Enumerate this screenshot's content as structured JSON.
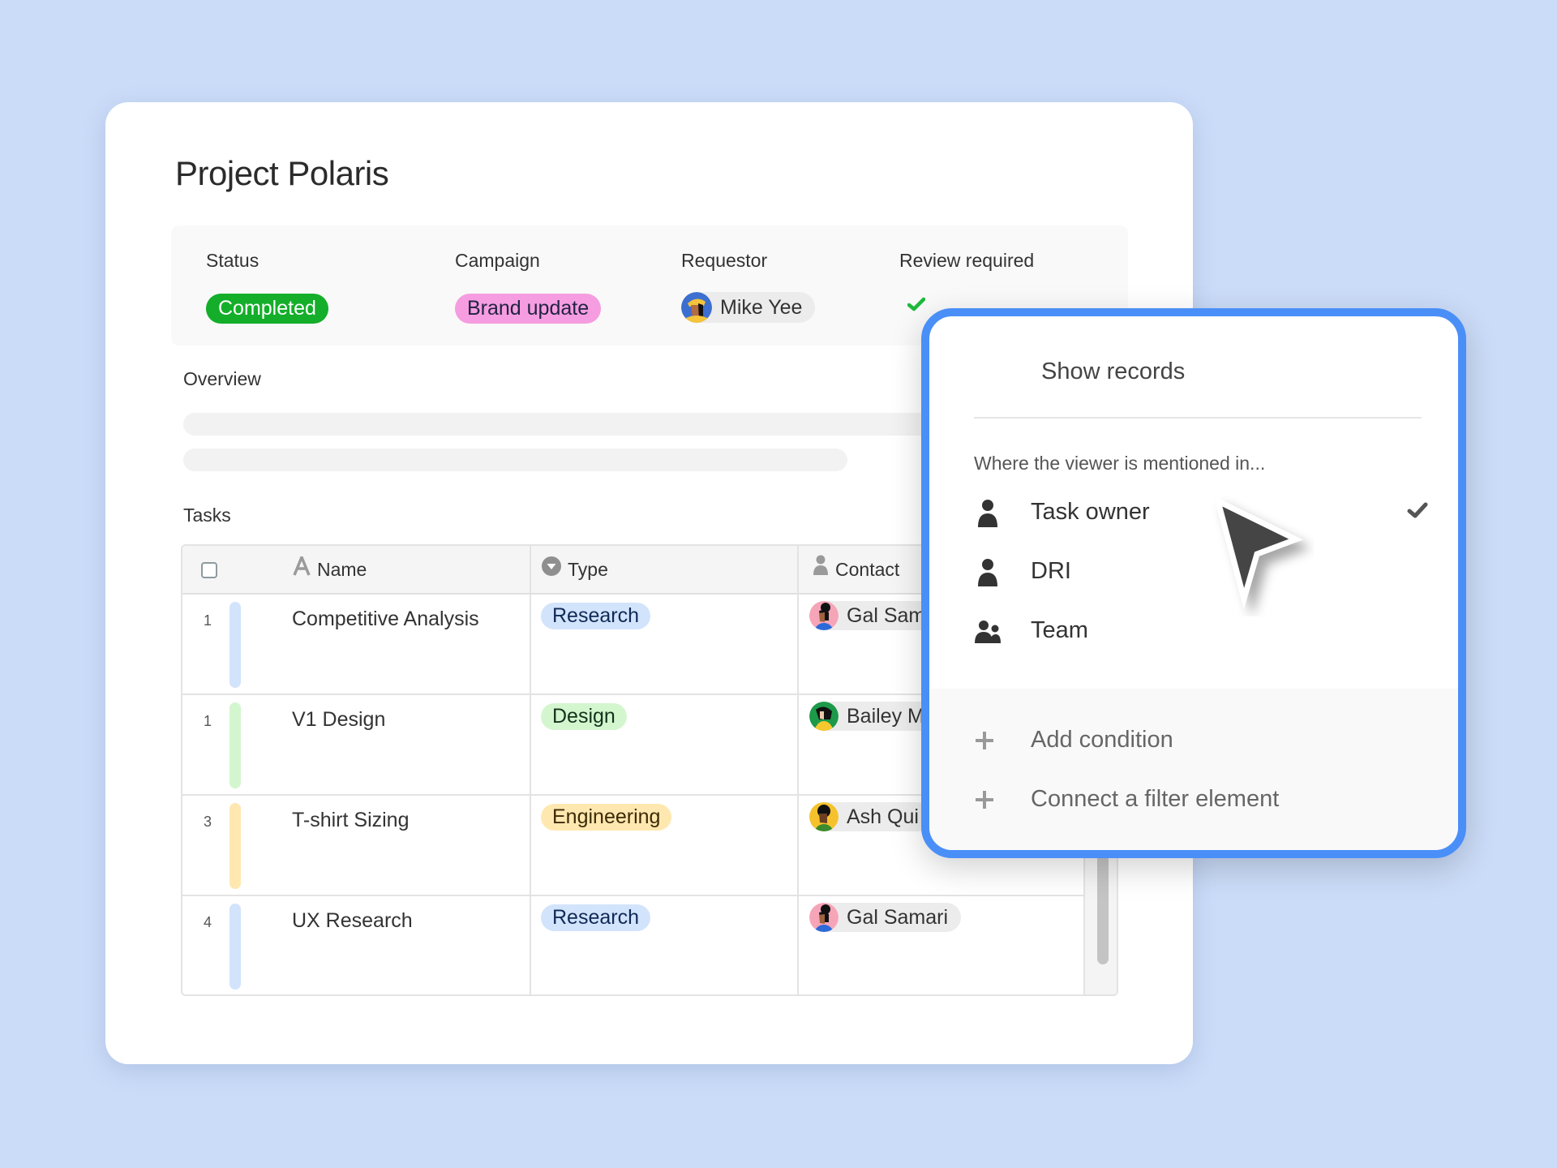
{
  "colors": {
    "background": "#cbdcf8",
    "popup_border": "#4a8ff8",
    "status_completed": "#14ae2a",
    "campaign_brand_update": "#f59de0",
    "type_research": "#d2e3fc",
    "type_design": "#d4f6cf",
    "type_engineering": "#ffe8b0",
    "check_green": "#20b83b"
  },
  "page": {
    "title": "Project Polaris"
  },
  "meta": {
    "status": {
      "label": "Status",
      "value": "Completed"
    },
    "campaign": {
      "label": "Campaign",
      "value": "Brand update"
    },
    "requestor": {
      "label": "Requestor",
      "value": "Mike Yee",
      "avatar_icon": "avatar-mike-yee"
    },
    "review": {
      "label": "Review required",
      "value_icon": "checkmark-icon",
      "checked": true
    }
  },
  "overview": {
    "label": "Overview"
  },
  "tasks": {
    "label": "Tasks",
    "columns": [
      {
        "label": "Name",
        "icon": "text-field-icon"
      },
      {
        "label": "Type",
        "icon": "single-select-icon"
      },
      {
        "label": "Contact",
        "icon": "person-icon"
      }
    ],
    "rows": [
      {
        "num": "1",
        "name": "Competitive Analysis",
        "type": "Research",
        "contact": "Gal Samari",
        "contact_visible": "Gal Sam",
        "color": "research"
      },
      {
        "num": "1",
        "name": "V1 Design",
        "type": "Design",
        "contact": "Bailey M",
        "contact_visible": "Bailey M",
        "color": "design"
      },
      {
        "num": "3",
        "name": "T-shirt Sizing",
        "type": "Engineering",
        "contact": "Ash Qui",
        "contact_visible": "Ash Qui",
        "color": "engineering"
      },
      {
        "num": "4",
        "name": "UX Research",
        "type": "Research",
        "contact": "Gal Samari",
        "contact_visible": "Gal Samari",
        "color": "research"
      }
    ]
  },
  "popup": {
    "title": "Show records",
    "subtitle": "Where the viewer is mentioned in...",
    "options": [
      {
        "label": "Task owner",
        "icon": "person-icon",
        "selected": true
      },
      {
        "label": "DRI",
        "icon": "person-icon",
        "selected": false
      },
      {
        "label": "Team",
        "icon": "people-icon",
        "selected": false
      }
    ],
    "footer": [
      {
        "label": "Add condition",
        "icon": "plus-icon"
      },
      {
        "label": "Connect a filter element",
        "icon": "plus-icon"
      }
    ]
  }
}
